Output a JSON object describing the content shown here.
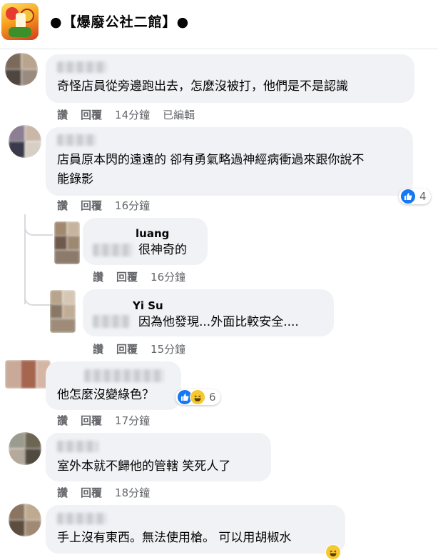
{
  "group": {
    "title": "●【爆廢公社二館】●"
  },
  "actions": {
    "like": "讚",
    "reply": "回覆",
    "edited": "已編輯"
  },
  "comments": [
    {
      "text": "奇怪店員從旁邊跑出去，怎麼沒被打，他們是不是認識",
      "time": "14分鐘",
      "edited": true
    },
    {
      "text_line1": "店員原本閃的遠遠的 卻有勇氣略過神經病衝過來跟你說不",
      "text_line2": "能錄影",
      "time": "16分鐘",
      "reaction_count": "4",
      "replies": [
        {
          "name": "luang",
          "text": "很神奇的",
          "time": "16分鐘"
        },
        {
          "name": "Yi Su",
          "text": "因為他發現...外面比較安全....",
          "time": "15分鐘"
        }
      ]
    },
    {
      "text": "他怎麼沒變綠色？",
      "time": "17分鐘",
      "reaction_count": "6"
    },
    {
      "text": "室外本就不歸他的管轄 笑死人了",
      "time": "18分鐘"
    },
    {
      "text": "手上沒有東西。無法使用槍。 可以用胡椒水"
    }
  ],
  "colors": {
    "bubble": "#f0f2f5",
    "meta": "#65676b",
    "like_blue": "#1877f2",
    "haha_yellow": "#f7c930"
  }
}
